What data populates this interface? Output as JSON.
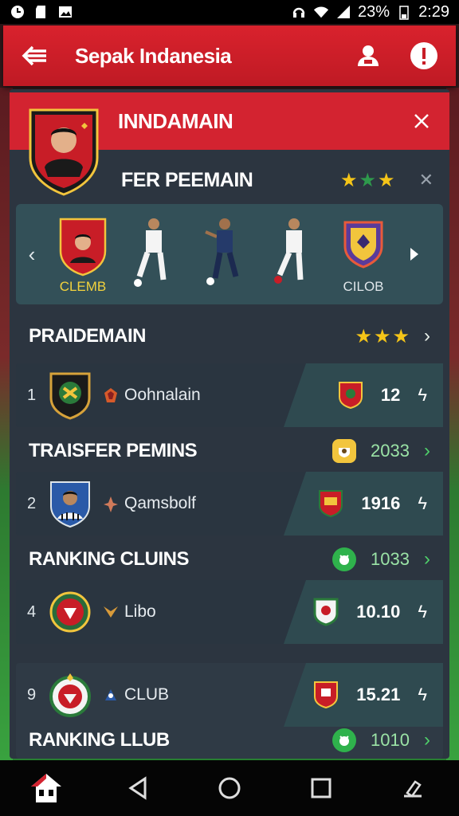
{
  "status": {
    "battery": "23%",
    "time": "2:29"
  },
  "app_bar": {
    "title": "Sepak Indanesia"
  },
  "header": {
    "title": "INNDAMAIN"
  },
  "sub_header": {
    "title": "FER PEEMAIN"
  },
  "carousel": {
    "items": [
      {
        "label": "CLEMB"
      },
      {
        "label": ""
      },
      {
        "label": ""
      },
      {
        "label": ""
      },
      {
        "label": "CILOB"
      }
    ]
  },
  "sections": [
    {
      "title": "PRAIDEMAIN"
    },
    {
      "title": "TRAISFER PEMINS",
      "value": "2033"
    },
    {
      "title": "RANKING CLUINS",
      "value": "1033"
    },
    {
      "title": "RANKING LLUB",
      "value": "1010"
    }
  ],
  "rows": [
    {
      "rank": "1",
      "name": "Oohnalain",
      "value": "12"
    },
    {
      "rank": "2",
      "name": "Qamsbolf",
      "value": "1916"
    },
    {
      "rank": "4",
      "name": "Libo",
      "value": "10.10"
    },
    {
      "rank": "9",
      "name": "CLUB",
      "value": "15.21"
    }
  ],
  "colors": {
    "accent": "#d32330",
    "star_gold": "#f5c518",
    "star_green": "#2e9a4c",
    "panel": "#2c3540",
    "teal_badge": "#2fb24c"
  }
}
